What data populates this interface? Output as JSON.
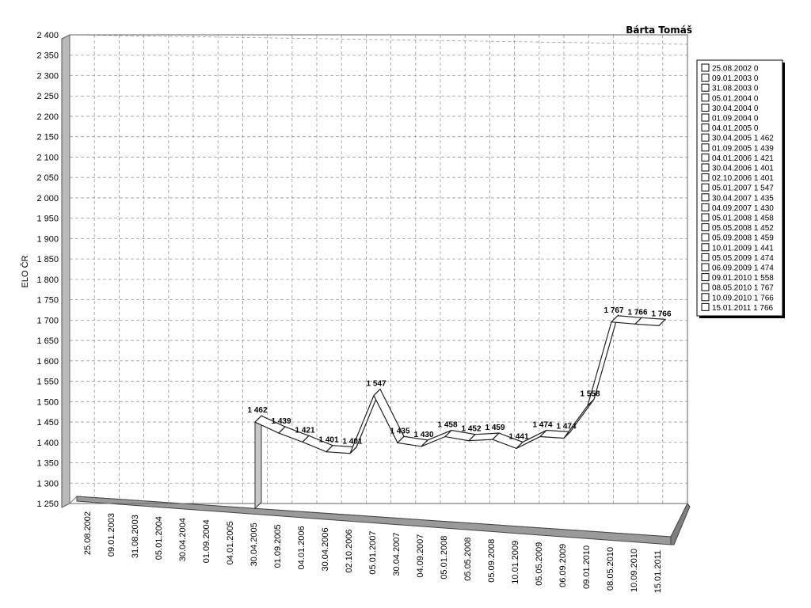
{
  "chart_data": {
    "type": "line",
    "title": "Bárta Tomáš",
    "ylabel": "ELO ČR",
    "xlabel": "",
    "ylim": [
      1250,
      2400
    ],
    "yticks": [
      "1 250",
      "1 300",
      "1 350",
      "1 400",
      "1 450",
      "1 500",
      "1 550",
      "1 600",
      "1 650",
      "1 700",
      "1 750",
      "1 800",
      "1 850",
      "1 900",
      "1 950",
      "2 000",
      "2 050",
      "2 100",
      "2 150",
      "2 200",
      "2 250",
      "2 300",
      "2 350",
      "2 400"
    ],
    "grid": true,
    "legend_position": "right",
    "categories": [
      "25.08.2002",
      "09.01.2003",
      "31.08.2003",
      "05.01.2004",
      "30.04.2004",
      "01.09.2004",
      "04.01.2005",
      "30.04.2005",
      "01.09.2005",
      "04.01.2006",
      "30.04.2006",
      "02.10.2006",
      "05.01.2007",
      "30.04.2007",
      "04.09.2007",
      "05.01.2008",
      "05.05.2008",
      "05.09.2008",
      "10.01.2009",
      "05.05.2009",
      "06.09.2009",
      "09.01.2010",
      "08.05.2010",
      "10.09.2010",
      "15.01.2011"
    ],
    "values": [
      0,
      0,
      0,
      0,
      0,
      0,
      0,
      1462,
      1439,
      1421,
      1401,
      1401,
      1547,
      1435,
      1430,
      1458,
      1452,
      1459,
      1441,
      1474,
      1474,
      1558,
      1767,
      1766,
      1766
    ],
    "data_labels": [
      "",
      "",
      "",
      "",
      "",
      "",
      "",
      "1 462",
      "1 439",
      "1 421",
      "1 401",
      "1 401",
      "1 547",
      "1 435",
      "1 430",
      "1 458",
      "1 452",
      "1 459",
      "1 441",
      "1 474",
      "1 474",
      "1 558",
      "1 767",
      "1 766",
      "1 766"
    ],
    "legend": [
      "25.08.2002 0",
      "09.01.2003 0",
      "31.08.2003 0",
      "05.01.2004 0",
      "30.04.2004 0",
      "01.09.2004 0",
      "04.01.2005 0",
      "30.04.2005 1 462",
      "01.09.2005 1 439",
      "04.01.2006 1 421",
      "30.04.2006 1 401",
      "02.10.2006 1 401",
      "05.01.2007 1 547",
      "30.04.2007 1 435",
      "04.09.2007 1 430",
      "05.01.2008 1 458",
      "05.05.2008 1 452",
      "05.09.2008 1 459",
      "10.01.2009 1 441",
      "05.05.2009 1 474",
      "06.09.2009 1 474",
      "09.01.2010 1 558",
      "08.05.2010 1 767",
      "10.09.2010 1 766",
      "15.01.2011 1 766"
    ]
  }
}
